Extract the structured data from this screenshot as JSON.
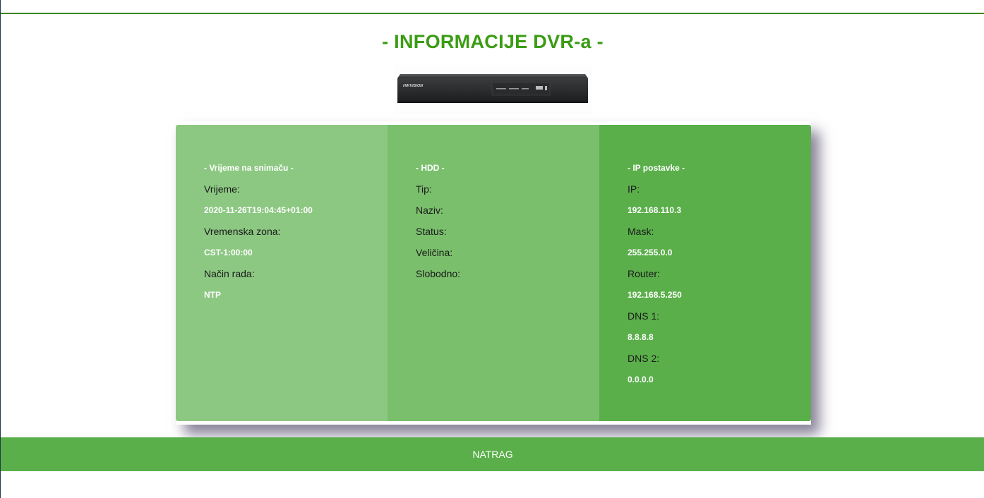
{
  "header": {
    "title": "- INFORMACIJE DVR-a -"
  },
  "device": {
    "brand": "HIKVISION"
  },
  "time_section": {
    "title": "- Vrijeme na snimaču -",
    "time_label": "Vrijeme:",
    "time_value": "2020-11-26T19:04:45+01:00",
    "zone_label": "Vremenska zona:",
    "zone_value": "CST-1:00:00",
    "mode_label": "Način rada:",
    "mode_value": "NTP"
  },
  "hdd_section": {
    "title": "- HDD -",
    "type_label": "Tip:",
    "name_label": "Naziv:",
    "status_label": "Status:",
    "size_label": "Veličina:",
    "free_label": "Slobodno:"
  },
  "ip_section": {
    "title": "- IP postavke -",
    "ip_label": "IP:",
    "ip_value": "192.168.110.3",
    "mask_label": "Mask:",
    "mask_value": "255.255.0.0",
    "router_label": "Router:",
    "router_value": "192.168.5.250",
    "dns1_label": "DNS 1:",
    "dns1_value": "8.8.8.8",
    "dns2_label": "DNS 2:",
    "dns2_value": "0.0.0.0"
  },
  "footer": {
    "back_label": "NATRAG"
  },
  "colors": {
    "title_green": "#3a9c13",
    "col1": "#8cc882",
    "col2": "#7abf6c",
    "col3": "#5aaf4a",
    "bar": "#5aaf4a"
  }
}
